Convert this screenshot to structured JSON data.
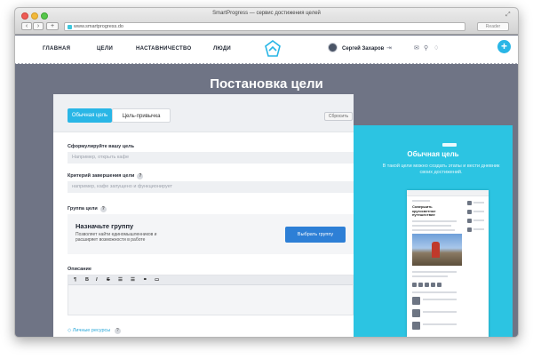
{
  "window": {
    "title": "SmartProgress — сервис достижения целей",
    "url": "www.smartprogress.do",
    "reader_label": "Reader"
  },
  "nav": {
    "items": [
      "ГЛАВНАЯ",
      "ЦЕЛИ",
      "НАСТАВНИЧЕСТВО",
      "ЛЮДИ"
    ],
    "user_name": "Сергей Захаров"
  },
  "icons": {
    "logout": "logout-icon",
    "mail": "mail-icon",
    "profile": "user-icon",
    "notifications": "bell-icon",
    "add": "plus-icon"
  },
  "page": {
    "title": "Постановка цели"
  },
  "form": {
    "tabs": [
      "Обычная цель",
      "Цель-привычка"
    ],
    "reset_label": "Сбросить",
    "goal_label": "Сформулируйте вашу цель",
    "goal_placeholder": "Например, открыть кафе",
    "criteria_label": "Критерий завершения цели",
    "criteria_placeholder": "например, кафе запущено и функционирует",
    "group_label": "Группа цели",
    "group_title": "Назначьте группу",
    "group_desc": "Позволяет найти единомышленников и расширяет возможности в работе",
    "group_button": "Выбрать группу",
    "description_label": "Описание",
    "toolbar": [
      "¶",
      "B",
      "I",
      "S",
      "☰",
      "☰",
      "⚭",
      "▭"
    ],
    "resources_label": "Личные ресурсы",
    "help_mark": "?"
  },
  "sidebar": {
    "title": "Обычная цель",
    "text": "В такой цели можно создать этапы и вести дневник своих достижений."
  },
  "preview": {
    "title": "Совершить кругосветное путешествие"
  },
  "colors": {
    "accent": "#29b6e6",
    "header_bg": "#6f7485",
    "button_blue": "#2d7fd6",
    "sidebar_bg": "#2cc4e2"
  }
}
